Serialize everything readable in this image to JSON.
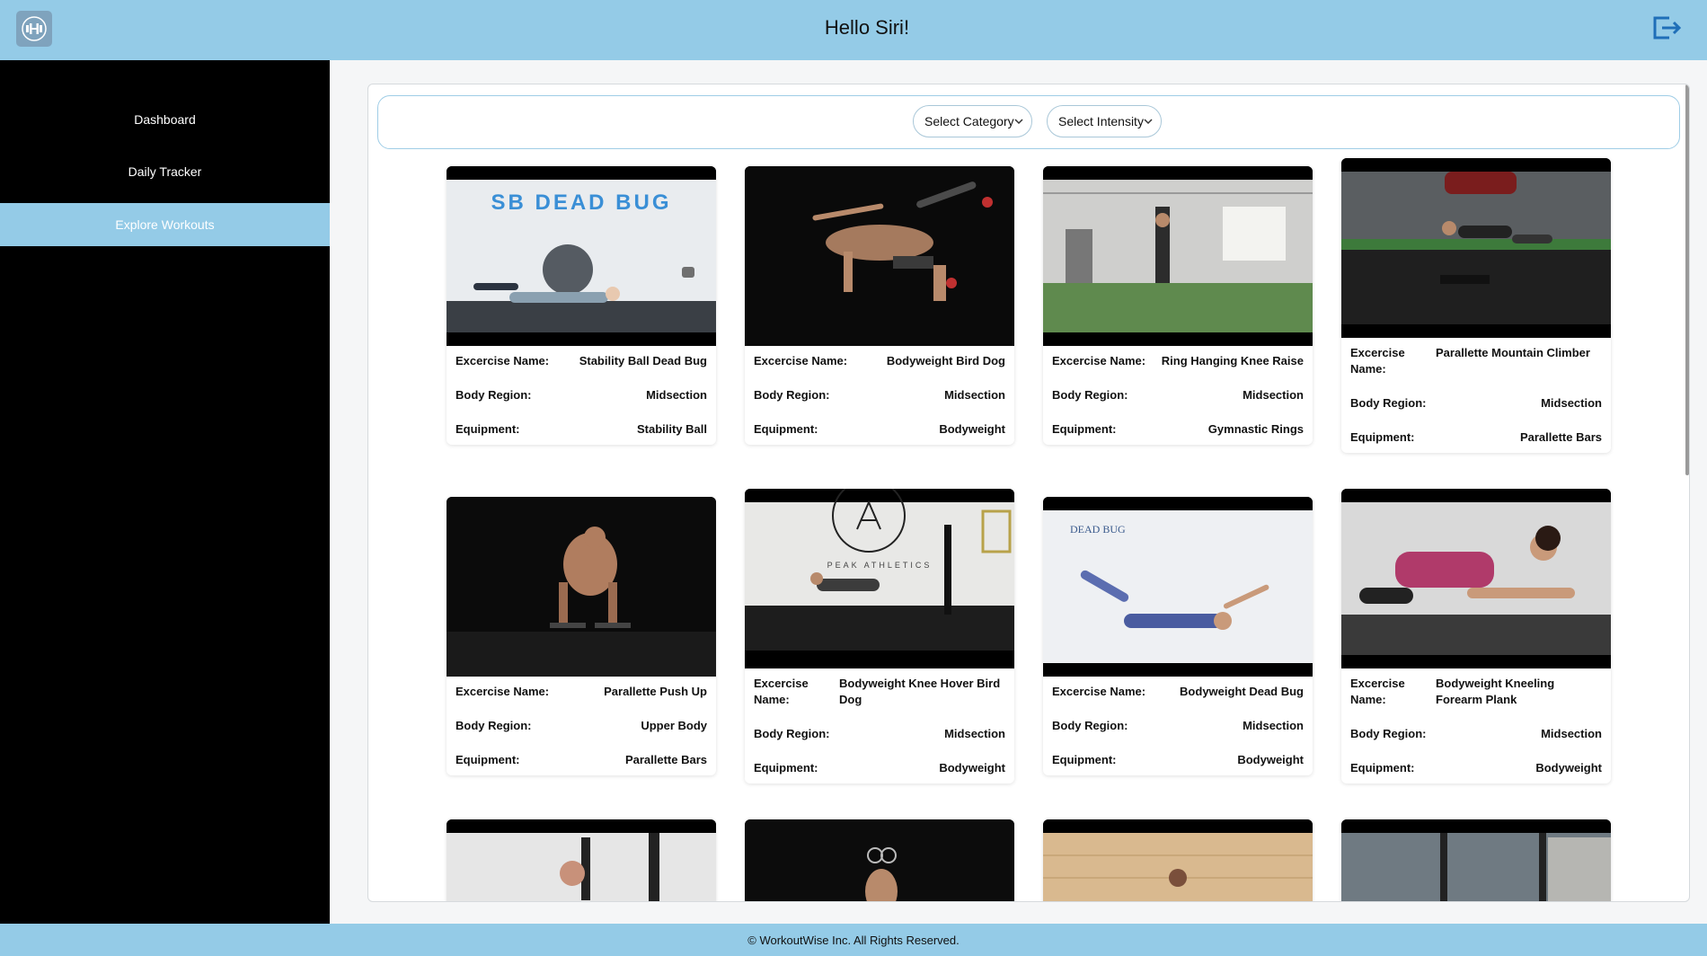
{
  "header": {
    "greeting": "Hello Siri!",
    "logo_icon": "dumbbell-icon",
    "logout_icon": "logout-icon"
  },
  "sidebar": {
    "items": [
      {
        "label": "Dashboard",
        "active": false
      },
      {
        "label": "Daily Tracker",
        "active": false
      },
      {
        "label": "Explore Workouts",
        "active": true
      }
    ]
  },
  "filters": {
    "category": "Select Category",
    "intensity": "Select Intensity"
  },
  "labels": {
    "name": "Excercise Name:",
    "region": "Body Region:",
    "equipment": "Equipment:"
  },
  "workouts": [
    {
      "name": "Stability Ball Dead Bug",
      "region": "Midsection",
      "equipment": "Stability Ball",
      "thumb_text": "SB DEAD BUG"
    },
    {
      "name": "Bodyweight Bird Dog",
      "region": "Midsection",
      "equipment": "Bodyweight"
    },
    {
      "name": "Ring Hanging Knee Raise",
      "region": "Midsection",
      "equipment": "Gymnastic Rings"
    },
    {
      "name": "Parallette Mountain Climber",
      "region": "Midsection",
      "equipment": "Parallette Bars"
    },
    {
      "name": "Parallette Push Up",
      "region": "Upper Body",
      "equipment": "Parallette Bars"
    },
    {
      "name": "Bodyweight Knee Hover Bird Dog",
      "region": "Midsection",
      "equipment": "Bodyweight",
      "thumb_text": "PEAK ATHLETICS"
    },
    {
      "name": "Bodyweight Dead Bug",
      "region": "Midsection",
      "equipment": "Bodyweight",
      "thumb_text": "DEAD BUG"
    },
    {
      "name": "Bodyweight Kneeling Forearm Plank",
      "region": "Midsection",
      "equipment": "Bodyweight"
    }
  ],
  "footer": {
    "text": "© WorkoutWise Inc. All Rights Reserved."
  },
  "colors": {
    "header": "#94cbe7",
    "sidebar": "#000000",
    "active_nav": "#94cbe7"
  }
}
